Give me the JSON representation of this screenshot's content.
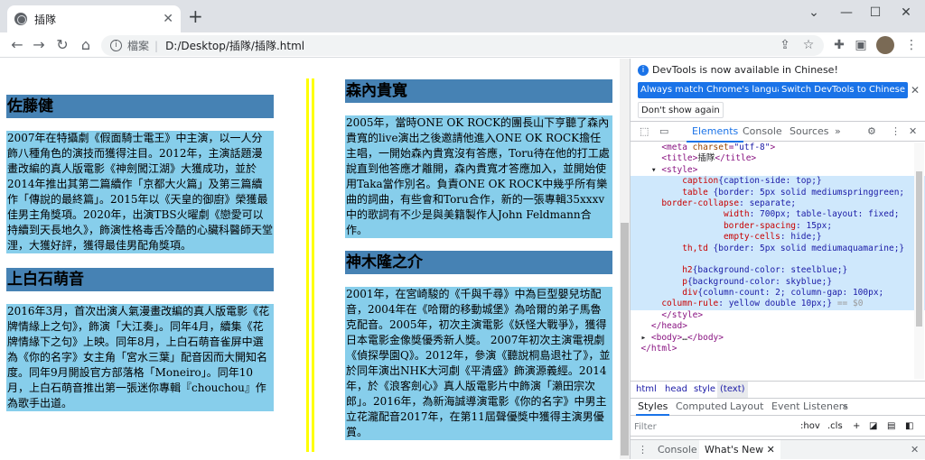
{
  "browser": {
    "tab_title": "插隊",
    "new_tab": "+",
    "address_label": "檔案",
    "address_url": "D:/Desktop/插隊/插隊.html",
    "icons": [
      "globe-icon",
      "close-icon",
      "minimize-icon",
      "maximize-icon",
      "chevron-down-icon",
      "back-icon",
      "forward-icon",
      "reload-icon",
      "home-icon",
      "info-icon",
      "share-icon",
      "star-icon",
      "puzzle-icon",
      "sidepanel-icon",
      "menu-icon"
    ]
  },
  "page": {
    "left": [
      {
        "heading": "佐藤健",
        "body": "2007年在特攝劇《假面騎士電王》中主演，以一人分飾八種角色的演技而獲得注目。2012年，主演話題漫畫改編的真人版電影《神劍闖江湖》大獲成功，並於2014年推出其第二篇續作「京都大火篇」及第三篇續作「傳說的最終篇」。2015年以《天皇的御廚》榮獲最佳男主角獎項。2020年，出演TBS火曜劇《戀愛可以持續到天長地久》，飾演性格毒舌冷酷的心臟科醫師天堂浬，大獲好評，獲得最佳男配角獎項。"
      },
      {
        "heading": "上白石萌音",
        "body": "2016年3月，首次出演人氣漫畫改編的真人版電影《花牌情緣上之句》，飾演「大江奏」。同年4月，續集《花牌情緣下之句》上映。同年8月，上白石萌音雀屏中選為《你的名字》女主角「宮水三葉」配音因而大開知名度。同年9月開設官方部落格「Moneiro」。同年10月，上白石萌音推出第一張迷你專輯『chouchou』作為歌手出道。"
      }
    ],
    "right": [
      {
        "heading": "森內貴寬",
        "body": "2005年，當時ONE OK ROCK的團長山下亨聽了森內貴寬的live演出之後邀請他進入ONE OK ROCK擔任主唱，一開始森內貴寬沒有答應，Toru待在他的打工處說直到他答應才離開，森內貴寬才答應加入，並開始使用Taka當作別名。負責ONE OK ROCK中幾乎所有樂曲的詞曲，有些會和Toru合作，新的一張專輯35xxxv中的歌詞有不少是與美籍製作人John Feldmann合作。"
      },
      {
        "heading": "神木隆之介",
        "body": "2001年，在宮崎駿的《千與千尋》中為巨型嬰兒坊配音，2004年在《哈爾的移動城堡》為哈爾的弟子馬魯克配音。2005年，初次主演電影《妖怪大戰爭》，獲得日本電影金像獎優秀新人獎。 2007年初次主演電視劇《偵探學園Q》。2012年，參演《聽說桐島退社了》，並於同年演出NHK大河劇《平清盛》飾演源義經。2014年，於《浪客劍心》真人版電影片中飾演「瀨田宗次郎」。2016年，為新海誠導演電影《你的名字》中男主立花瀧配音2017年，在第11屆聲優獎中獲得主演男優賞。"
      }
    ]
  },
  "devtools": {
    "info_message": "DevTools is now available in Chinese!",
    "btn_match": "Always match Chrome's language",
    "btn_switch": "Switch DevTools to Chinese",
    "btn_dontshow": "Don't show again",
    "tabs": [
      "Elements",
      "Console",
      "Sources",
      "»"
    ],
    "code_lines": [
      {
        "i": "      ",
        "t": "<meta ",
        "a": "charset",
        "v": "\"utf-8\"",
        "e": ">"
      },
      {
        "i": "      ",
        "t": "<title>",
        "x": "插隊",
        "e": "</title>"
      },
      {
        "i": "    ▾ ",
        "t": "<style>"
      },
      {
        "i": "          ",
        "p": "caption",
        "c": "{caption-side: top;}"
      },
      {
        "i": "          ",
        "p": "table",
        "c": " {border: 5px solid mediumspringgreen;"
      },
      {
        "i": "      ",
        "p": "border-collapse",
        "c": ": separate;"
      },
      {
        "i": "                  ",
        "p": "width",
        "c": ": 700px; table-layout: fixed;"
      },
      {
        "i": "                  ",
        "p": "border-spacing",
        "c": ": 15px;"
      },
      {
        "i": "                  ",
        "p": "empty-cells",
        "c": ": hide;}"
      },
      {
        "i": "          ",
        "p": "th,td",
        "c": " {border: 5px solid mediumaquamarine;}"
      },
      {
        "i": "",
        "c": ""
      },
      {
        "i": "          ",
        "p": "h2",
        "c": "{background-color: steelblue;}"
      },
      {
        "i": "          ",
        "p": "p",
        "c": "{background-color: skyblue;}"
      },
      {
        "i": "          ",
        "p": "div",
        "c": "{column-count: 2; column-gap: 100px;"
      },
      {
        "i": "      ",
        "p": "column-rule",
        "c": ": yellow double 10px;}",
        "d": " == $0"
      },
      {
        "i": "      ",
        "t": "</style>"
      },
      {
        "i": "    ",
        "t": "</head>"
      },
      {
        "i": "  ▸ ",
        "t": "<body>",
        "x": "…",
        "e": "</body>"
      },
      {
        "i": "  ",
        "t": "</html>"
      }
    ],
    "crumbs": [
      "html",
      "head",
      "style",
      "(text)"
    ],
    "styles_tabs": [
      "Styles",
      "Computed",
      "Layout",
      "Event Listeners",
      "»"
    ],
    "filter_placeholder": "Filter",
    "filter_hov": ":hov",
    "filter_cls": ".cls",
    "drawer_tabs": [
      "Console",
      "What's New"
    ]
  }
}
